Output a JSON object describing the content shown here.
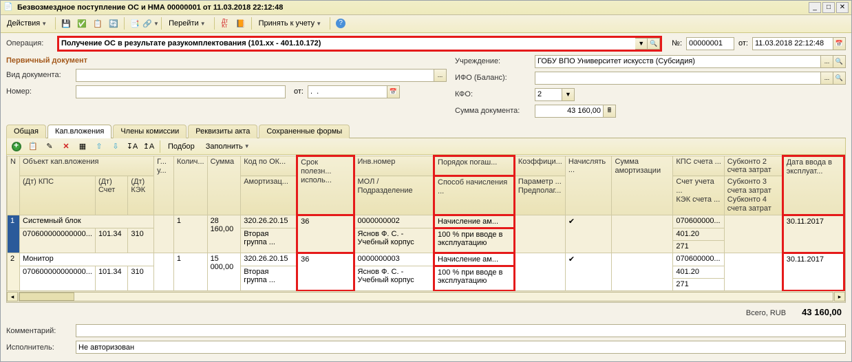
{
  "window": {
    "title": "Безвозмездное поступление ОС и НМА 00000001 от 11.03.2018 22:12:48"
  },
  "toolbar": {
    "actions": "Действия",
    "go": "Перейти",
    "take": "Принять к учету"
  },
  "form": {
    "operation_lbl": "Операция:",
    "operation": "Получение ОС в результате разукомплектования (101.xx - 401.10.172)",
    "num_lbl_short": "№:",
    "num": "00000001",
    "date_lbl": "от:",
    "date": "11.03.2018 22:12:48",
    "primary_doc": "Первичный документ",
    "doc_type_lbl": "Вид документа:",
    "doc_type": "",
    "num_lbl": "Номер:",
    "num2": "",
    "ot_lbl": "от:",
    "ot": ".  .",
    "org_lbl": "Учреждение:",
    "org": "ГОБУ ВПО Университет искусств (Субсидия)",
    "ifo_lbl": "ИФО (Баланс):",
    "ifo": "",
    "kfo_lbl": "КФО:",
    "kfo": "2",
    "sum_lbl": "Сумма документа:",
    "sum": "43 160,00"
  },
  "tabs": [
    "Общая",
    "Кап.вложения",
    "Члены комиссии",
    "Реквизиты акта",
    "Сохраненные формы"
  ],
  "subtoolbar": {
    "podbor": "Подбор",
    "zapolnit": "Заполнить"
  },
  "columns": {
    "n": "N",
    "obj": "Объект кап.вложения",
    "dtkps": "(Дт) КПС",
    "dtschet": "(Дт) Счет",
    "dtkek": "(Дт) КЭК",
    "g": "Г... у...",
    "qty": "Колич...",
    "sum": "Сумма",
    "okof": "Код по ОК...",
    "amort": "Амортизац...",
    "srok": "Срок полезн... исполь...",
    "inv": "Инв.номер",
    "mol": "МОЛ / Подразделение",
    "pogash": "Порядок погаш...",
    "sposob": "Способ начисления ...",
    "koef": "Коэффици...",
    "param": "Параметр ...",
    "predpolag": "Предполаг...",
    "nachisl": "Начислять ...",
    "sumamort": "Сумма амортизации",
    "kps_schet": "КПС счета ...",
    "schet_ucheta": "Счет учета ...",
    "kek_schet": "КЭК счета ...",
    "sub2": "Субконто 2 счета затрат",
    "sub3": "Субконто 3 счета затрат",
    "sub4": "Субконто 4 счета затрат",
    "data_vvoda": "Дата ввода в эксплуат..."
  },
  "rows": [
    {
      "n": "1",
      "obj": "Системный блок",
      "kps": "070600000000000...",
      "dtschet": "101.34",
      "dtkek": "310",
      "qty": "1",
      "sum": "28 160,00",
      "okof": "320.26.20.15",
      "amort": "Вторая группа ...",
      "srok": "36",
      "inv": "0000000002",
      "mol": "Яснов Ф. С. - Учебный корпус",
      "pogash": "Начисление ам...",
      "sposob": "100 % при вводе в эксплуатацию",
      "nachisl": "✔",
      "kps_s": "070600000...",
      "schet_u": "401.20",
      "kek_s": "271",
      "data": "30.11.2017"
    },
    {
      "n": "2",
      "obj": "Монитор",
      "kps": "070600000000000...",
      "dtschet": "101.34",
      "dtkek": "310",
      "qty": "1",
      "sum": "15 000,00",
      "okof": "320.26.20.15",
      "amort": "Вторая группа ...",
      "srok": "36",
      "inv": "0000000003",
      "mol": "Яснов Ф. С. - Учебный корпус",
      "pogash": "Начисление ам...",
      "sposob": "100 % при вводе в эксплуатацию",
      "nachisl": "✔",
      "kps_s": "070600000...",
      "schet_u": "401.20",
      "kek_s": "271",
      "data": "30.11.2017"
    }
  ],
  "totals": {
    "lbl": "Всего, RUB",
    "val": "43 160,00"
  },
  "footer": {
    "comment_lbl": "Комментарий:",
    "comment": "",
    "executor_lbl": "Исполнитель:",
    "executor": "Не авторизован"
  }
}
